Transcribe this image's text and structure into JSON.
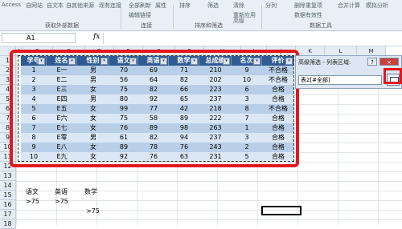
{
  "ribbon": {
    "commands": [
      "Access",
      "自网站",
      "自文本",
      "自其他来源",
      "现有连接",
      "全部刷新",
      "属性",
      "编辑链接",
      "排序",
      "筛选",
      "清除",
      "重新应用",
      "高级",
      "分列",
      "删除重复项",
      "数据有效性",
      "合并计算",
      "模拟分析",
      "组合",
      "取消组合",
      "分类汇总"
    ],
    "groups": [
      "获取外部数据",
      "连接",
      "排序和筛选",
      "数据工具"
    ]
  },
  "formula_bar": {
    "name_box": "A1",
    "fx_label": "fx",
    "formula": ""
  },
  "columns": [
    "A",
    "B",
    "C",
    "D",
    "E",
    "F",
    "G",
    "H",
    "I",
    "J",
    "K",
    "L",
    "M"
  ],
  "rows": [
    "1",
    "2",
    "3",
    "4",
    "5",
    "6",
    "7",
    "8",
    "9",
    "10",
    "11",
    "12",
    "13",
    "14",
    "15",
    "16",
    "17",
    "18"
  ],
  "table": {
    "headers": [
      "学号",
      "姓名",
      "性别",
      "语文",
      "英语",
      "数学",
      "总成绩",
      "名次",
      "评价"
    ],
    "rows": [
      [
        "1",
        "E一",
        "男",
        "70",
        "69",
        "71",
        "210",
        "9",
        "不合格"
      ],
      [
        "2",
        "E二",
        "男",
        "56",
        "64",
        "82",
        "202",
        "10",
        "不合格"
      ],
      [
        "3",
        "E三",
        "女",
        "75",
        "82",
        "66",
        "223",
        "6",
        "合格"
      ],
      [
        "4",
        "E四",
        "男",
        "80",
        "92",
        "65",
        "237",
        "3",
        "合格"
      ],
      [
        "5",
        "E五",
        "女",
        "99",
        "77",
        "42",
        "218",
        "8",
        "不合格"
      ],
      [
        "6",
        "E六",
        "女",
        "75",
        "58",
        "89",
        "222",
        "7",
        "合格"
      ],
      [
        "7",
        "E七",
        "女",
        "76",
        "89",
        "98",
        "263",
        "1",
        "合格"
      ],
      [
        "8",
        "E零",
        "男",
        "61",
        "82",
        "94",
        "237",
        "3",
        "合格"
      ],
      [
        "9",
        "E八",
        "女",
        "89",
        "78",
        "76",
        "243",
        "2",
        "合格"
      ],
      [
        "10",
        "E九",
        "女",
        "92",
        "76",
        "63",
        "231",
        "5",
        "合格"
      ]
    ]
  },
  "criteria": {
    "headers": [
      "语文",
      "英语",
      "数学"
    ],
    "row16": [
      ">75",
      ">75",
      ""
    ],
    "row17": [
      "",
      "",
      ">75"
    ]
  },
  "dialog": {
    "title": "高级筛选 - 列表区域:",
    "help": "?",
    "close": "×",
    "range_value": "表2[#全部]"
  },
  "colors": {
    "header_bg": "#2f5b93",
    "band_dark": "#b9cfe8",
    "band_light": "#dbe7f4",
    "highlight": "#e3171e"
  }
}
